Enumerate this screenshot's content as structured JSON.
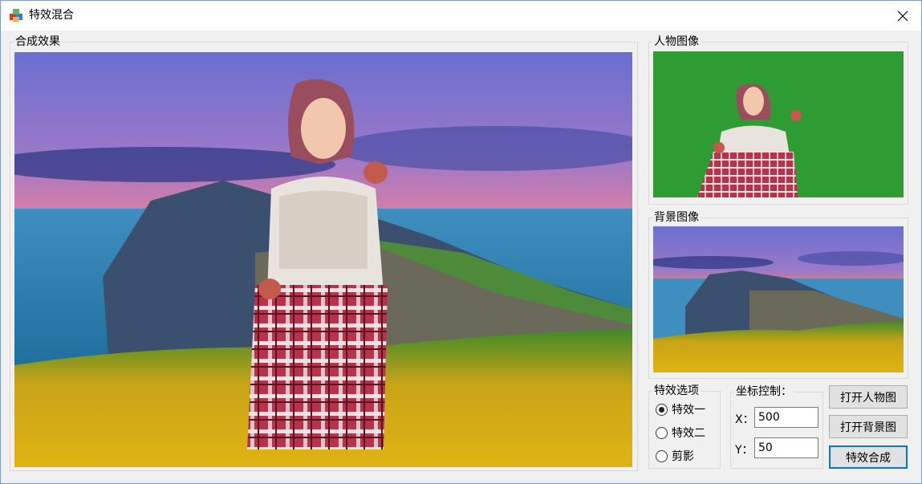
{
  "window": {
    "title": "特效混合",
    "close_icon": "close-icon"
  },
  "composite": {
    "label": "合成效果"
  },
  "person": {
    "label": "人物图像"
  },
  "background": {
    "label": "背景图像"
  },
  "effects": {
    "label": "特效选项",
    "options": [
      {
        "label": "特效一",
        "checked": true
      },
      {
        "label": "特效二",
        "checked": false
      },
      {
        "label": "剪影",
        "checked": false
      }
    ]
  },
  "coords": {
    "label": "坐标控制：",
    "x_label": "X：",
    "x_value": "500",
    "y_label": "Y：",
    "y_value": "50"
  },
  "buttons": {
    "open_person": "打开人物图",
    "open_background": "打开背景图",
    "composite": "特效合成"
  },
  "colors": {
    "green_screen": "#2e9b33",
    "accent": "#0078d7"
  }
}
